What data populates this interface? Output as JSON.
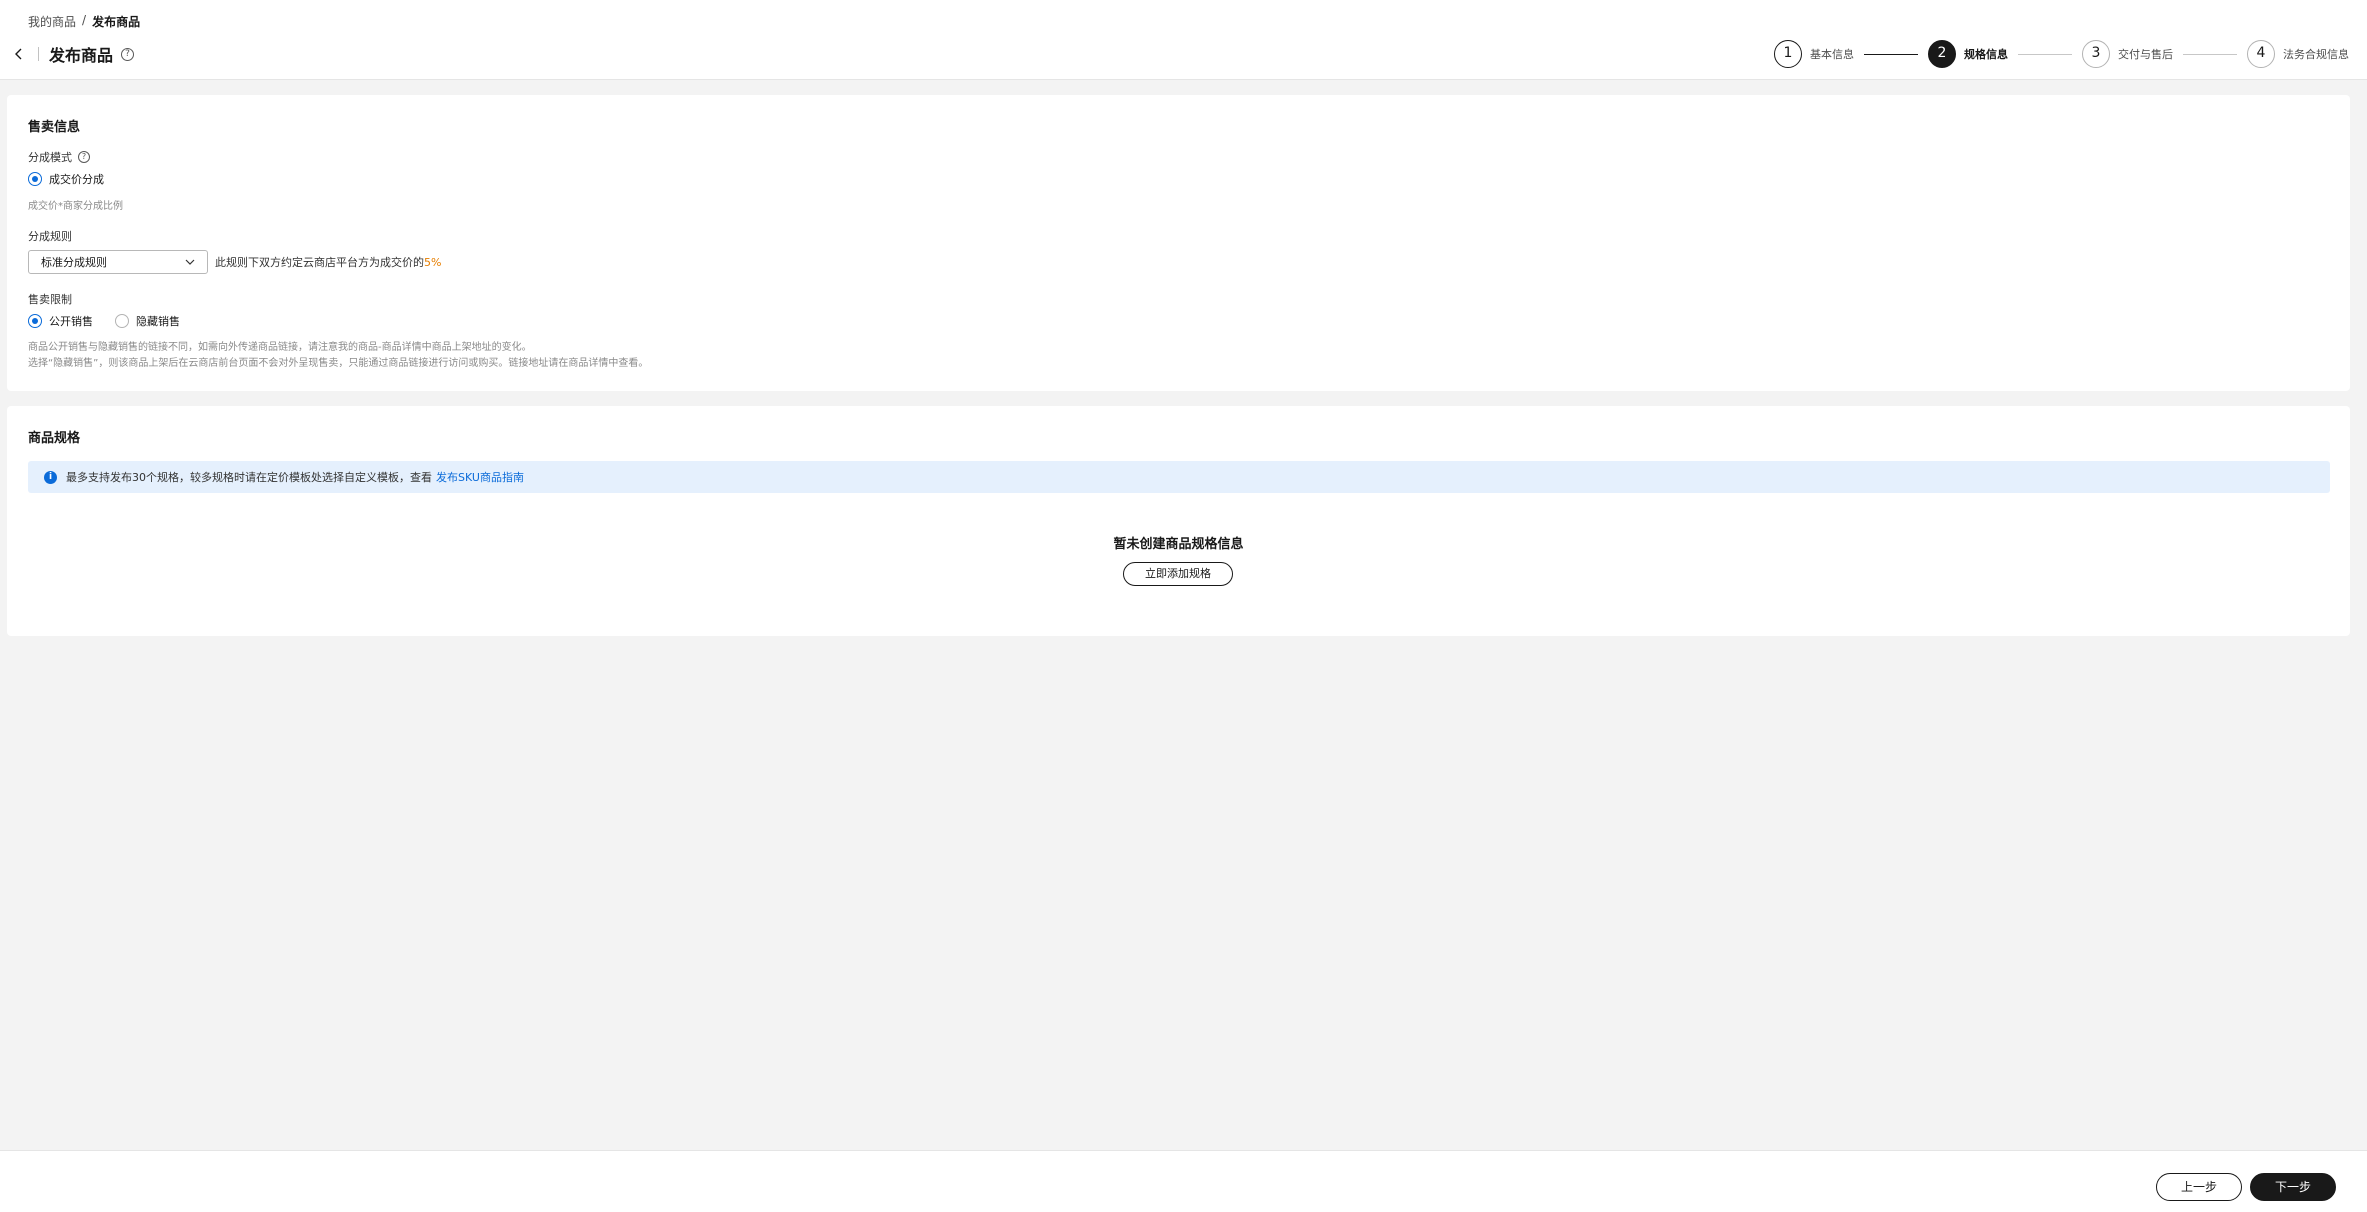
{
  "header": {
    "breadcrumb": [
      "我的商品",
      "/",
      "发布商品"
    ],
    "title": "发布商品",
    "help_glyph": "?"
  },
  "steps": [
    {
      "num": "1",
      "label": "基本信息",
      "state": "done"
    },
    {
      "num": "2",
      "label": "规格信息",
      "state": "active"
    },
    {
      "num": "3",
      "label": "交付与售后",
      "state": "todo"
    },
    {
      "num": "4",
      "label": "法务合规信息",
      "state": "todo"
    }
  ],
  "sales_info": {
    "title": "售卖信息",
    "share_mode_label": "分成模式",
    "share_mode_option": "成交价分成",
    "share_mode_hint": "成交价*商家分成比例",
    "share_rule_label": "分成规则",
    "share_rule_value": "标准分成规则",
    "share_rule_note": "此规则下双方约定云商店平台方为成交价的",
    "share_rule_pct": "5%",
    "restriction_label": "售卖限制",
    "restriction_options": [
      "公开销售",
      "隐藏销售"
    ],
    "restriction_selected": "公开销售",
    "restriction_hint1": "商品公开销售与隐藏销售的链接不同，如需向外传递商品链接，请注意我的商品-商品详情中商品上架地址的变化。",
    "restriction_hint2": "选择“隐藏销售”，则该商品上架后在云商店前台页面不会对外呈现售卖，只能通过商品链接进行访问或购买。链接地址请在商品详情中查看。"
  },
  "spec": {
    "title": "商品规格",
    "info_text": "最多支持发布30个规格，较多规格时请在定价模板处选择自定义模板，查看",
    "info_link": "发布SKU商品指南",
    "empty_title": "暂未创建商品规格信息",
    "add_button": "立即添加规格"
  },
  "footer": {
    "prev": "上一步",
    "next": "下一步"
  },
  "colors": {
    "accent": "#0b6bd9",
    "highlight": "#e67e00",
    "dark": "#191919"
  }
}
